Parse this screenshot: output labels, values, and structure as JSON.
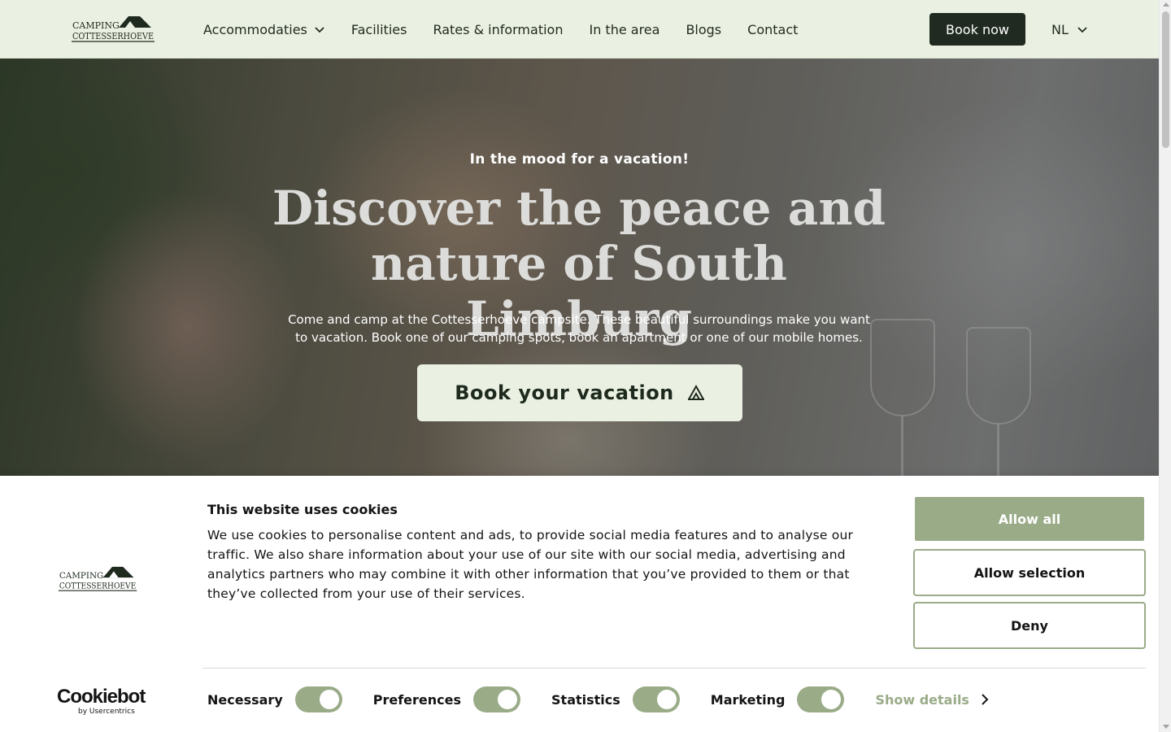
{
  "brand": {
    "logo_text_line1": "CAMPING",
    "logo_text_line2": "COTTESSERHOEVE"
  },
  "nav": {
    "items": [
      {
        "label": "Accommodaties",
        "has_dropdown": true
      },
      {
        "label": "Facilities"
      },
      {
        "label": "Rates & information"
      },
      {
        "label": "In the area"
      },
      {
        "label": "Blogs"
      },
      {
        "label": "Contact"
      }
    ],
    "book_now": "Book now",
    "language": "NL"
  },
  "hero": {
    "kicker": "In the mood for a vacation!",
    "headline": "Discover the peace and nature of South Limburg",
    "lead": "Come and camp at the Cottesserhoeve campsite. These beautiful surroundings make you want to vacation. Book one of our camping spots, book an apartment or one of our mobile homes.",
    "cta": "Book your vacation"
  },
  "cookie": {
    "title": "This website uses cookies",
    "text": "We use cookies to personalise content and ads, to provide social media features and to analyse our traffic. We also share information about your use of our site with our social media, advertising and analytics partners who may combine it with other information that you’ve provided to them or that they’ve collected from your use of their services.",
    "allow_all": "Allow all",
    "allow_selection": "Allow selection",
    "deny": "Deny",
    "toggles": [
      {
        "label": "Necessary",
        "on": true
      },
      {
        "label": "Preferences",
        "on": true
      },
      {
        "label": "Statistics",
        "on": true
      },
      {
        "label": "Marketing",
        "on": true
      }
    ],
    "show_details": "Show details",
    "cookiebot_name": "Cookiebot",
    "cookiebot_sub": "by Usercentrics"
  },
  "colors": {
    "header_bg": "#ebf1e2",
    "dark": "#202a20",
    "accent": "#9aab88"
  }
}
